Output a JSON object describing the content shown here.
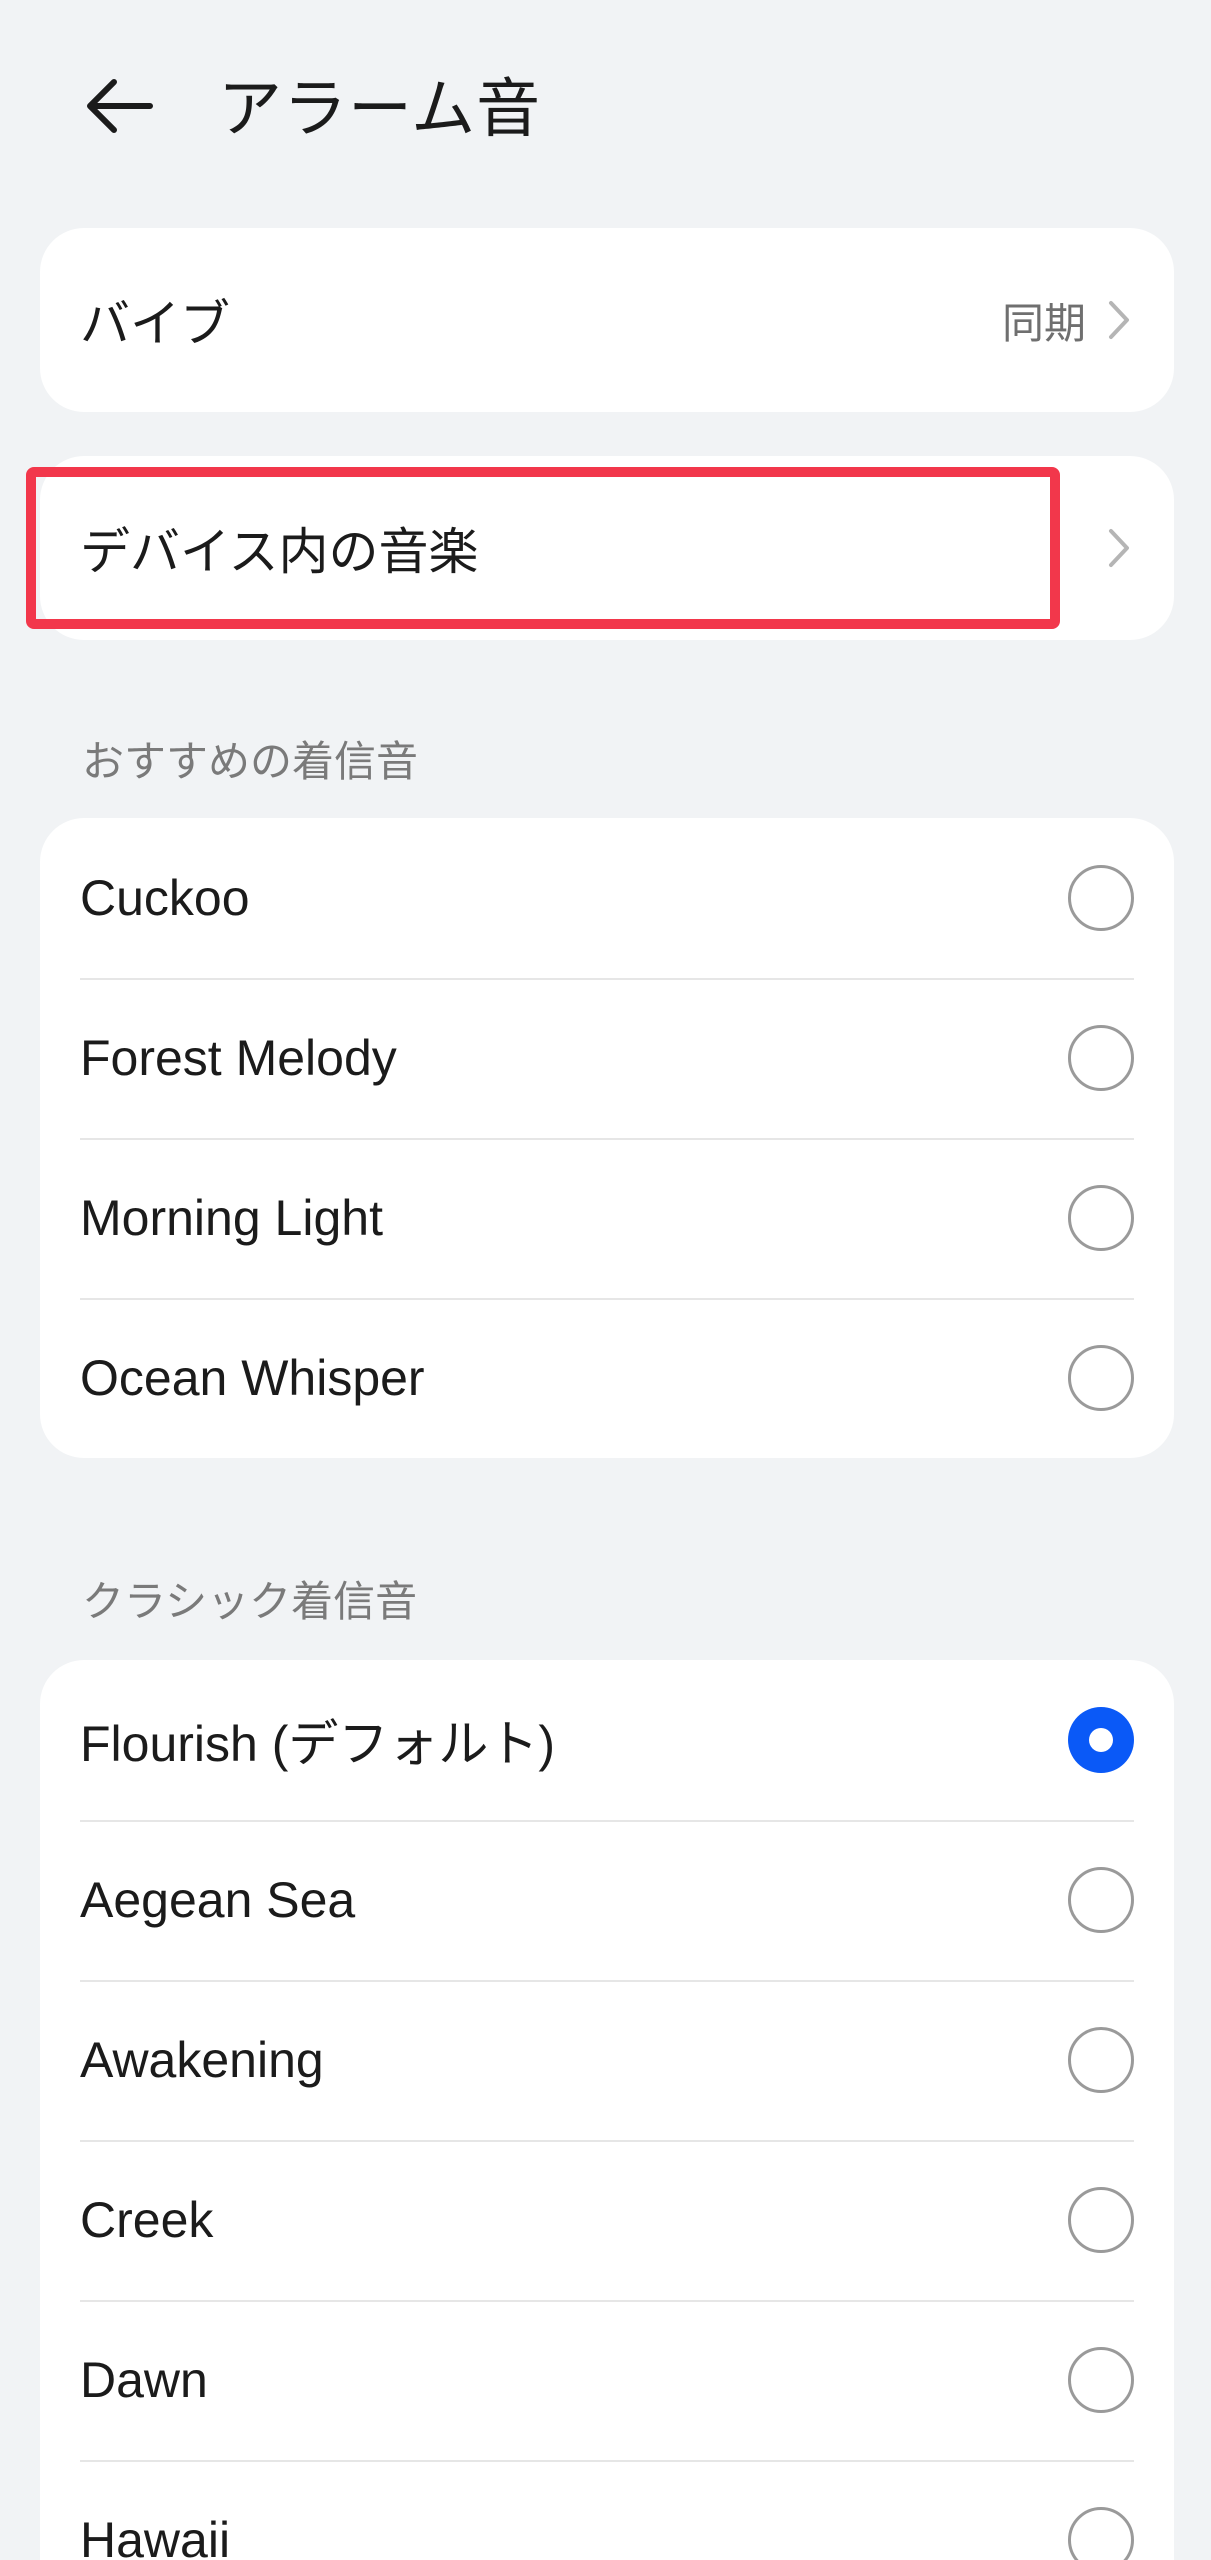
{
  "header": {
    "back_icon": "arrow-left-icon",
    "title": "アラーム音"
  },
  "vibration": {
    "label": "バイブ",
    "value": "同期",
    "chevron_icon": "chevron-right-icon"
  },
  "device_music": {
    "label": "デバイス内の音楽",
    "chevron_icon": "chevron-right-icon"
  },
  "recommended": {
    "title": "おすすめの着信音",
    "items": [
      {
        "label": "Cuckoo",
        "selected": false
      },
      {
        "label": "Forest Melody",
        "selected": false
      },
      {
        "label": "Morning Light",
        "selected": false
      },
      {
        "label": "Ocean Whisper",
        "selected": false
      }
    ]
  },
  "classic": {
    "title": "クラシック着信音",
    "items": [
      {
        "label": "Flourish (デフォルト)",
        "selected": true
      },
      {
        "label": "Aegean Sea",
        "selected": false
      },
      {
        "label": "Awakening",
        "selected": false
      },
      {
        "label": "Creek",
        "selected": false
      },
      {
        "label": "Dawn",
        "selected": false
      },
      {
        "label": "Hawaii",
        "selected": false
      }
    ]
  },
  "colors": {
    "background": "#f1f3f5",
    "card": "#ffffff",
    "accent": "#0a59f7",
    "highlight": "#f2374b"
  }
}
